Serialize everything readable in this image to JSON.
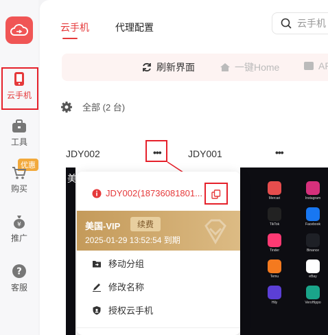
{
  "sidebar": {
    "items": [
      {
        "label": "云手机",
        "icon": "phone-icon"
      },
      {
        "label": "工具",
        "icon": "toolbox-icon"
      },
      {
        "label": "购买",
        "icon": "cart-icon",
        "badge": "优惠"
      },
      {
        "label": "推广",
        "icon": "money-bag-icon"
      },
      {
        "label": "客服",
        "icon": "help-icon"
      }
    ]
  },
  "tabs": [
    {
      "label": "云手机"
    },
    {
      "label": "代理配置"
    }
  ],
  "search": {
    "placeholder": "云手机"
  },
  "toolbar": {
    "refresh": "刷新界面",
    "home": "一键Home",
    "ap": "AP"
  },
  "filter": {
    "label": "全部 (2 台)"
  },
  "devices": [
    {
      "name": "JDY002"
    },
    {
      "name": "JDY001"
    }
  ],
  "popup": {
    "id_text": "JDY002(18736081801...",
    "vip_name": "美国-VIP",
    "renew": "续费",
    "expiry": "2025-01-29 13:52:54 到期",
    "menu": [
      {
        "label": "移动分组"
      },
      {
        "label": "修改名称"
      },
      {
        "label": "授权云手机"
      }
    ]
  },
  "phone_screen": {
    "left_title": "美",
    "apps": [
      "Mercari",
      "Instagram",
      "TikTok",
      "Facebook",
      "Tinder",
      "Binance",
      "Temu",
      "eBay",
      "Hily",
      "VeroHippo"
    ]
  },
  "colors": {
    "accent": "#e5393a",
    "vip": "#c49a5a",
    "badge": "#f2a93b"
  }
}
